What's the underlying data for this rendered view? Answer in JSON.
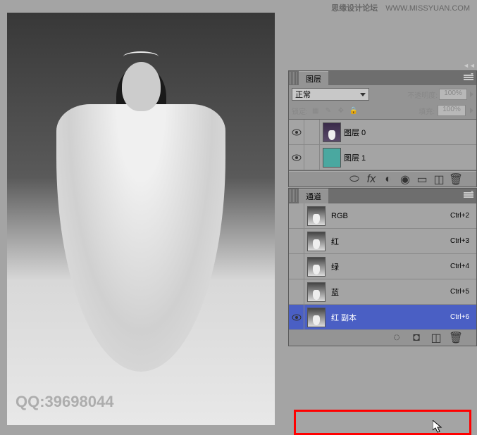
{
  "watermark": {
    "site_cn": "思缘设计论坛",
    "site_url": "WWW.MISSYUAN.COM"
  },
  "qq": "QQ:39698044",
  "layers_panel": {
    "title": "图层",
    "blend_mode": "正常",
    "opacity_label": "不透明度:",
    "opacity_value": "100%",
    "lock_label": "锁定:",
    "fill_label": "填充:",
    "fill_value": "100%",
    "layers": [
      {
        "name": "图层 0",
        "visible": true,
        "thumb": "dark"
      },
      {
        "name": "图层 1",
        "visible": true,
        "thumb": "teal"
      }
    ]
  },
  "channels_panel": {
    "title": "通道",
    "channels": [
      {
        "name": "RGB",
        "shortcut": "Ctrl+2",
        "visible": false,
        "selected": false
      },
      {
        "name": "红",
        "shortcut": "Ctrl+3",
        "visible": false,
        "selected": false
      },
      {
        "name": "绿",
        "shortcut": "Ctrl+4",
        "visible": false,
        "selected": false
      },
      {
        "name": "蓝",
        "shortcut": "Ctrl+5",
        "visible": false,
        "selected": false
      },
      {
        "name": "红 副本",
        "shortcut": "Ctrl+6",
        "visible": true,
        "selected": true
      }
    ]
  }
}
